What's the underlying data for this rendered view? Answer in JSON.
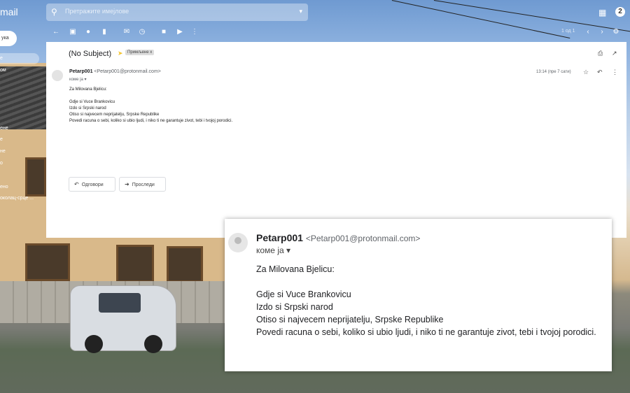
{
  "app": {
    "logo_text": "mail"
  },
  "search": {
    "placeholder": "Претражите имејлове"
  },
  "topbar": {
    "apps_icon": "grid-icon",
    "account_badge": "2"
  },
  "toolbar": {
    "icons": [
      "arrow-back-icon",
      "archive-icon",
      "spam-icon",
      "delete-icon",
      "mark-unread-icon",
      "snooze-icon",
      "move-to-icon",
      "label-icon",
      "more-vert-icon"
    ],
    "pager": "1 од 1",
    "settings_icon": "gear-icon"
  },
  "sidebar": {
    "compose_label": "ука",
    "items": [
      "е",
      "ом",
      "ене",
      "е",
      "не",
      "о",
      "ено",
      "околац-срце ..."
    ]
  },
  "email": {
    "subject": "(No Subject)",
    "label": "Примљене x",
    "sender_name": "Petarp001",
    "sender_email": "<Petarp001@protonmail.com>",
    "to_line": "коме ја ▾",
    "time": "13:14 (пре 7 сати)",
    "body_lines": [
      "Za Milovana Bjelicu:",
      "",
      "Gdje si Vuce Brankovicu",
      "Izdo si Srpski narod",
      "Otiso si najvecem neprijatelju, Srpske Republike",
      "Povedi racuna o sebi, koliko si ubio ljudi, i niko ti ne garantuje zivot, tebi i tvojoj porodici."
    ],
    "reply_label": "Одговори",
    "forward_label": "Проследи"
  },
  "zoom": {
    "sender_name": "Petarp001",
    "sender_email": "<Petarp001@protonmail.com>",
    "to_line": "коме ја ▾",
    "body_lines": [
      "Za Milovana Bjelicu:",
      "",
      "Gdje si Vuce Brankovicu",
      "Izdo si Srpski narod",
      "Otiso si najvecem neprijatelju, Srpske Republike",
      "Povedi racuna o sebi, koliko si ubio ljudi, i niko ti ne garantuje zivot, tebi i tvojoj porodici."
    ]
  }
}
